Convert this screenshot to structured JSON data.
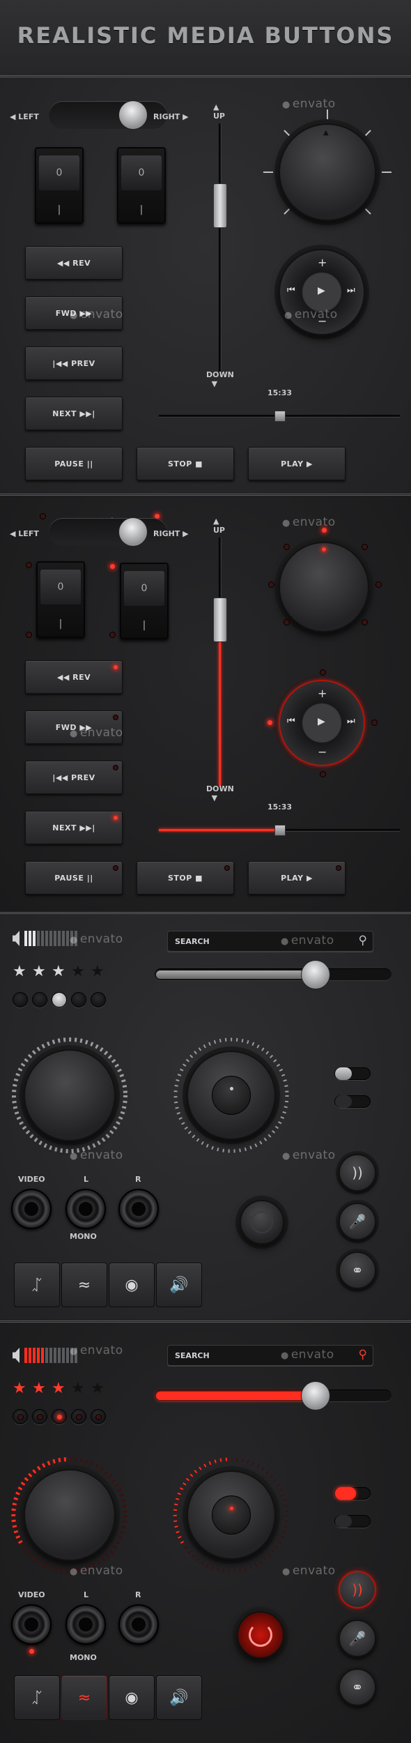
{
  "title": "REALISTIC MEDIA BUTTONS",
  "watermark": "envato",
  "accent": "#ff3b2d",
  "toggle": {
    "left": "LEFT",
    "right": "RIGHT"
  },
  "vslider": {
    "up": "UP",
    "down": "DOWN"
  },
  "hslider": {
    "time": "15:33"
  },
  "rocker": {
    "off": "0",
    "on": "|"
  },
  "buttons": {
    "rev": "REV",
    "fwd": "FWD",
    "prev": "PREV",
    "next": "NEXT",
    "pause": "PAUSE",
    "stop": "STOP",
    "play": "PLAY"
  },
  "icons": {
    "rev": "◀◀",
    "fwd": "▶▶",
    "prev": "|◀◀",
    "next": "▶▶|",
    "pause": "||",
    "stop": "■",
    "play": "▶"
  },
  "dpad": {
    "plus": "+",
    "minus": "−",
    "prev": "⏮",
    "play": "▶",
    "next": "⏭"
  },
  "search": {
    "label": "SEARCH"
  },
  "jacks": {
    "video": "VIDEO",
    "left": "L",
    "right": "R",
    "mono": "MONO"
  },
  "rating_dark": {
    "stars_filled": 3,
    "stars_total": 5
  },
  "rating_lit": {
    "stars_filled": 3,
    "stars_total": 5
  },
  "slider_level": 0.7
}
